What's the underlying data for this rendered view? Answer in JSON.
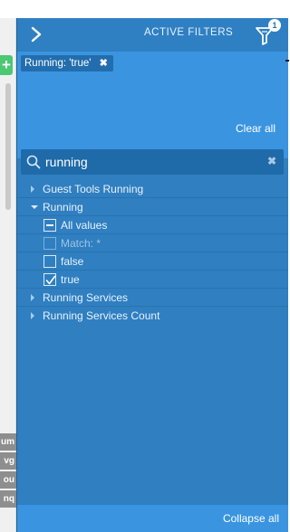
{
  "left_app": {
    "add_label": "+",
    "stubs": [
      "um",
      "vg",
      "ou",
      "nq"
    ]
  },
  "panel": {
    "title": "ACTIVE FILTERS",
    "filter_count": "1",
    "chip_label": "Running: 'true'",
    "chip_close": "✖",
    "clear_all": "Clear all",
    "search": {
      "value": "running",
      "clear": "✖"
    },
    "tree": [
      {
        "label": "Guest Tools Running",
        "state": "collapsed"
      },
      {
        "label": "Running",
        "state": "expanded"
      },
      {
        "label": "All values",
        "check": "partial"
      },
      {
        "label": "Match: *",
        "check": "disabled"
      },
      {
        "label": "false",
        "check": "unchecked"
      },
      {
        "label": "true",
        "check": "checked"
      },
      {
        "label": "Running Services",
        "state": "collapsed"
      },
      {
        "label": "Running Services Count",
        "state": "collapsed"
      }
    ],
    "collapse_all": "Collapse all"
  },
  "colors": {
    "panel_bg": "#2f7fc1",
    "accent_light": "#3a94e0",
    "chip_bg": "#226dae",
    "add_button": "#4cc774"
  }
}
